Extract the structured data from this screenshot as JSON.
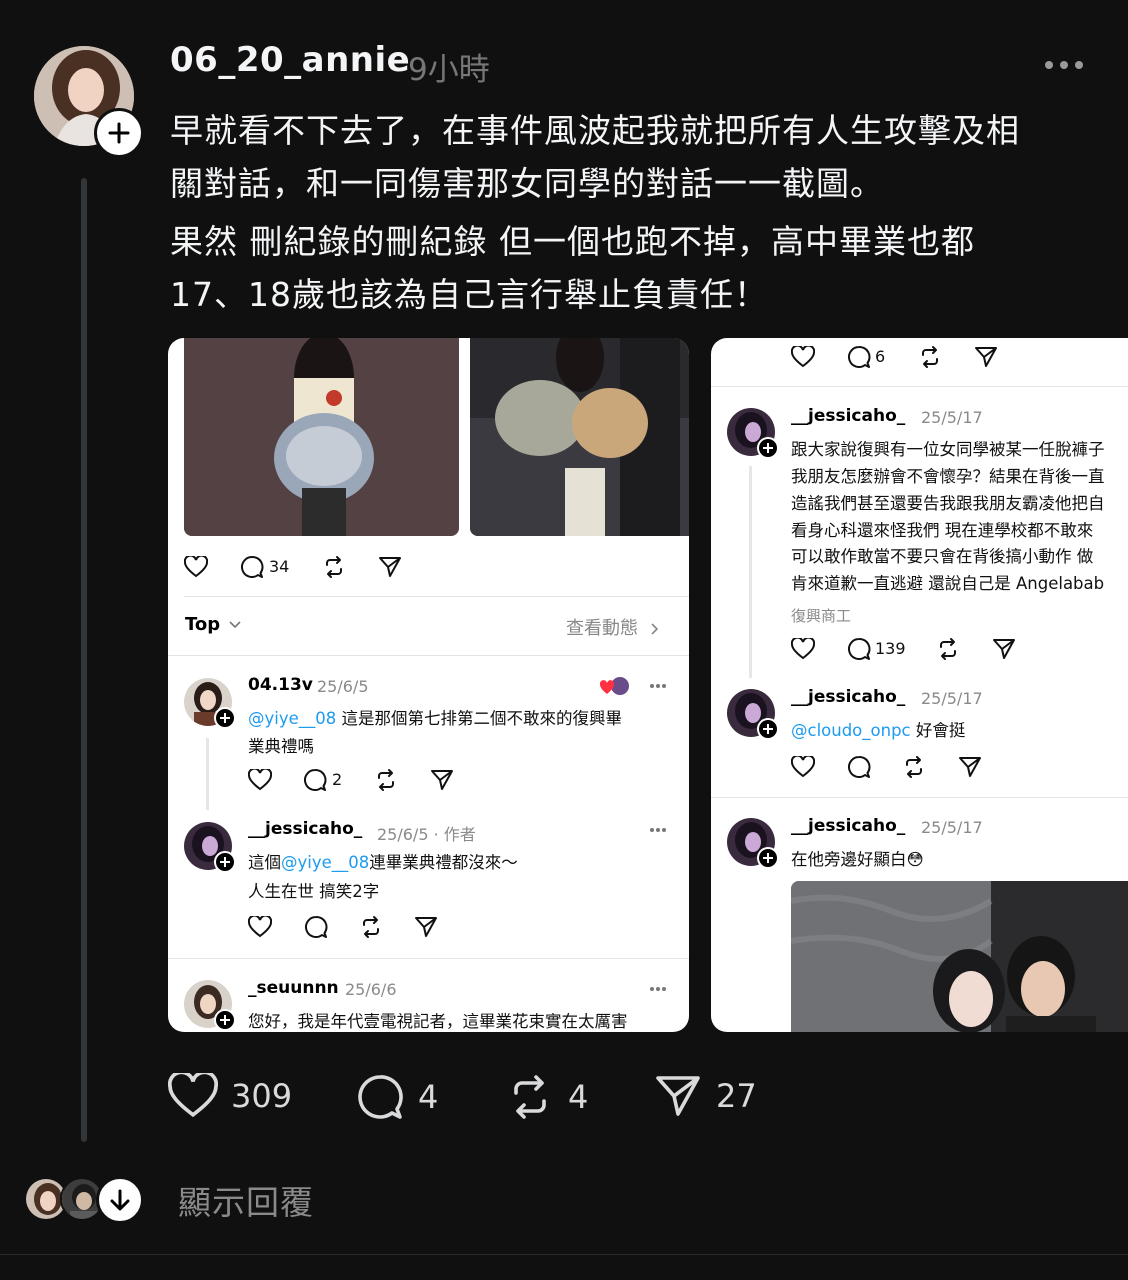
{
  "post": {
    "username": "06_20_annie",
    "time": "9小時",
    "lines": [
      "早就看不下去了，在事件風波起我就把所有人生攻擊及相",
      "關對話，和一同傷害那女同學的對話一一截圖。",
      "果然 刪紀錄的刪紀錄 但一個也跑不掉，高中畢業也都",
      "17、18歲也該為自己言行舉止負責任！"
    ],
    "stats": {
      "likes": "309",
      "comments": "4",
      "reposts": "4",
      "shares": "27"
    }
  },
  "card_left": {
    "top_post_comments": "34",
    "sort_label": "Top",
    "view_activity": "查看動態",
    "replies": [
      {
        "user": "04.13v",
        "date": "25/6/5",
        "mention": "@yiye__08",
        "text1": " 這是那個第七排第二個不敢來的復興畢",
        "text2": "業典禮嗎",
        "comments": "2"
      },
      {
        "user": "__jessicaho_",
        "date": "25/6/5 · 作者",
        "prefix": "這個",
        "mention": "@yiye__08",
        "text1": "連畢業典禮都沒來～",
        "text2": "人生在世 搞笑2字"
      },
      {
        "user": "_seuunnn",
        "date": "25/6/6",
        "text1": "您好，我是年代壹電視記者，這畢業花束實在太厲害"
      }
    ]
  },
  "card_right": {
    "top_comments": "6",
    "posts": [
      {
        "user": "__jessicaho_",
        "date": "25/5/17",
        "lines": [
          "跟大家說復興有一位女同學被某一任脫褲子",
          "我朋友怎麼辦會不會懷孕？結果在背後一直",
          "造謠我們甚至還要告我跟我朋友霸凌他把自",
          "看身心科還來怪我們 現在連學校都不敢來",
          "可以敢作敢當不要只會在背後搞小動作 做",
          "肯來道歉一直逃避 還說自己是 Angelabab"
        ],
        "tag": "復興商工",
        "comments": "139"
      },
      {
        "user": "__jessicaho_",
        "date": "25/5/17",
        "mention": "@cloudo_onpc",
        "text": " 好會挺"
      },
      {
        "user": "__jessicaho_",
        "date": "25/5/17",
        "text": "在他旁邊好顯白😳"
      }
    ]
  },
  "footer": {
    "show_replies": "顯示回覆"
  }
}
